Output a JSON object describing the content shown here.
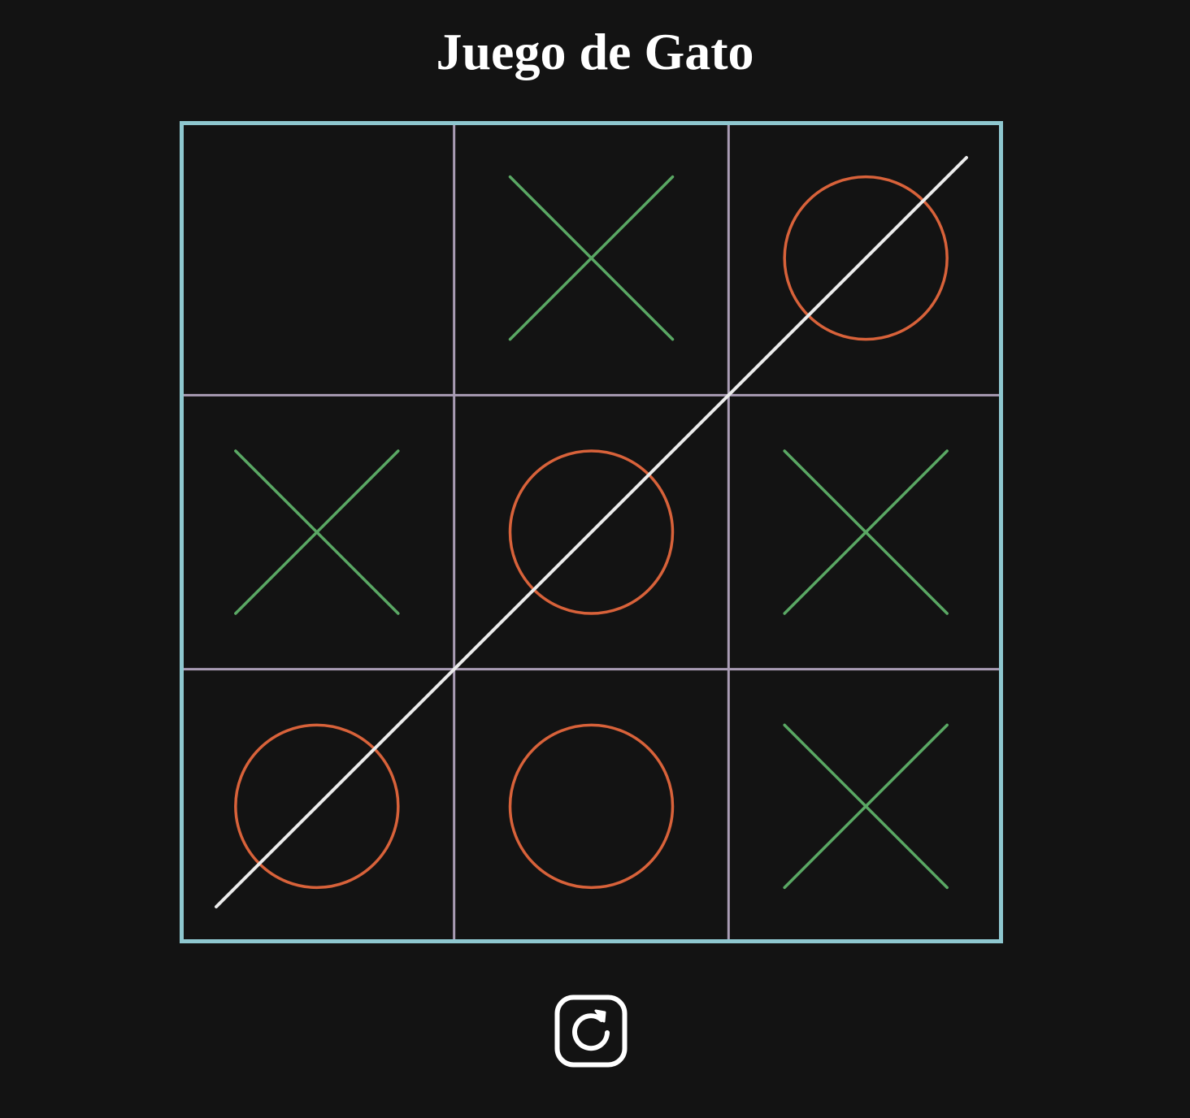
{
  "title": "Juego de Gato",
  "board": {
    "cells": [
      "",
      "X",
      "O",
      "X",
      "O",
      "X",
      "O",
      "O",
      "X"
    ],
    "winning_line": [
      6,
      4,
      2
    ]
  },
  "colors": {
    "background": "#131313",
    "board_border": "#8ec7cf",
    "grid_lines": "#a99cb4",
    "x_mark": "#5aa864",
    "o_mark": "#d8623a",
    "win_line": "#ececec",
    "title": "#ffffff",
    "reset_icon": "#ffffff"
  },
  "reset": {
    "icon": "restart-icon"
  }
}
